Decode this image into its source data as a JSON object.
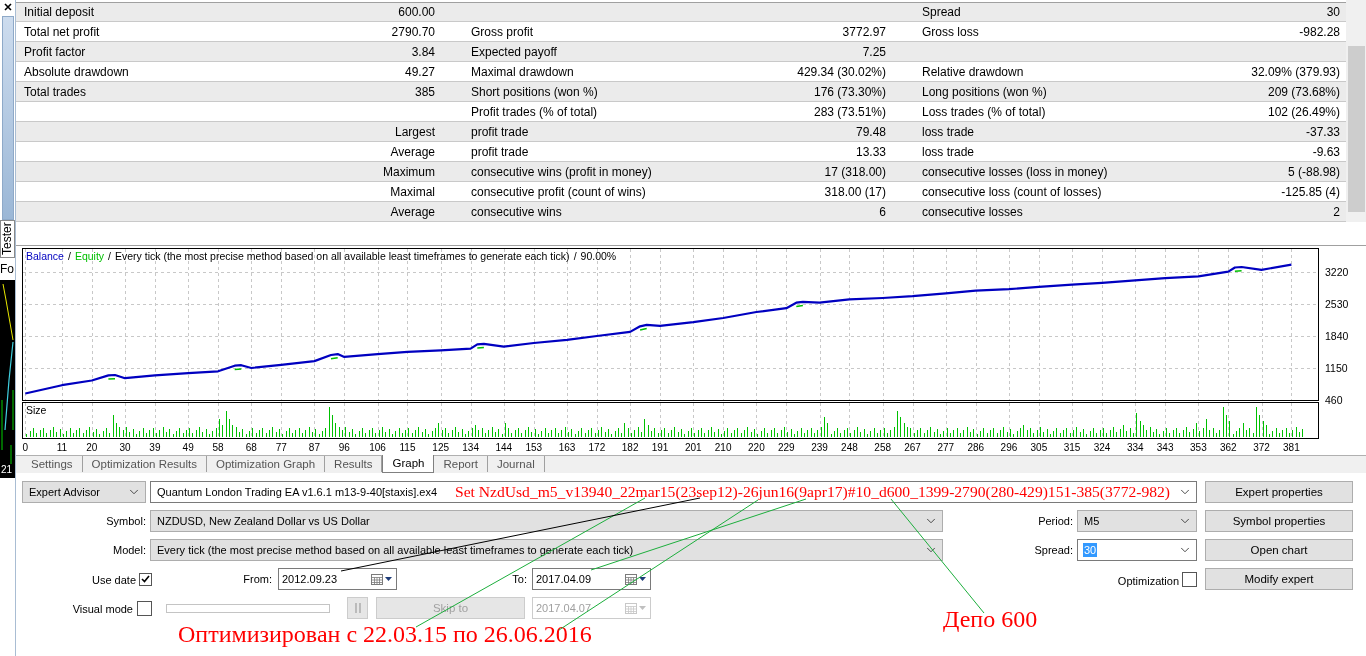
{
  "side_panel": {
    "tab_label": "Tester",
    "cut_label": "Fo",
    "corner_label": "21"
  },
  "report": {
    "rows": [
      {
        "col_1": "Initial deposit",
        "col_2": "600.00",
        "col_5": "Spread",
        "col_6": "30"
      },
      {
        "col_1": "Total net profit",
        "col_2": "2790.70",
        "col_3": "Gross profit",
        "col_4": "3772.97",
        "col_5": "Gross loss",
        "col_6": "-982.28"
      },
      {
        "col_1": "Profit factor",
        "col_2": "3.84",
        "col_3": "Expected payoff",
        "col_4": "7.25"
      },
      {
        "col_1": "Absolute drawdown",
        "col_2": "49.27",
        "col_3": "Maximal drawdown",
        "col_4": "429.34 (30.02%)",
        "col_5": "Relative drawdown",
        "col_6": "32.09% (379.93)"
      },
      {
        "col_1": "Total trades",
        "col_2": "385",
        "col_3": "Short positions (won %)",
        "col_4": "176 (73.30%)",
        "col_5": "Long positions (won %)",
        "col_6": "209 (73.68%)"
      },
      {
        "col_3": "Profit trades (% of total)",
        "col_4": "283 (73.51%)",
        "col_5": "Loss trades (% of total)",
        "col_6": "102 (26.49%)"
      },
      {
        "col_2": "Largest",
        "col_3": "profit trade",
        "col_4": "79.48",
        "col_5": "loss trade",
        "col_6": "-37.33"
      },
      {
        "col_2": "Average",
        "col_3": "profit trade",
        "col_4": "13.33",
        "col_5": "loss trade",
        "col_6": "-9.63"
      },
      {
        "col_2": "Maximum",
        "col_3": "consecutive wins (profit in money)",
        "col_4": "17 (318.00)",
        "col_5": "consecutive losses (loss in money)",
        "col_6": "5 (-88.98)"
      },
      {
        "col_2": "Maximal",
        "col_3": "consecutive profit (count of wins)",
        "col_4": "318.00 (17)",
        "col_5": "consecutive loss (count of losses)",
        "col_6": "-125.85 (4)"
      },
      {
        "col_2": "Average",
        "col_3": "consecutive wins",
        "col_4": "6",
        "col_5": "consecutive losses",
        "col_6": "2"
      }
    ]
  },
  "graph": {
    "separators": [
      "/",
      "/",
      "/"
    ],
    "model": "Every tick (the most precise method based on all available least timeframes to generate each tick)",
    "quality": "90.00%",
    "size_label": "Size",
    "chart_data": {
      "type": "line",
      "grid": true,
      "x": [
        0,
        11,
        20,
        25,
        27,
        30,
        39,
        49,
        58,
        63,
        65,
        68,
        77,
        87,
        92,
        94,
        96,
        106,
        115,
        125,
        134,
        136,
        138,
        144,
        153,
        163,
        172,
        182,
        185,
        187,
        191,
        201,
        210,
        220,
        229,
        232,
        234,
        239,
        248,
        258,
        267,
        277,
        286,
        296,
        305,
        315,
        324,
        334,
        343,
        353,
        362,
        364,
        366,
        372,
        381
      ],
      "series": [
        {
          "name": "Balance",
          "color": "#0000c0",
          "values": [
            600,
            780,
            880,
            990,
            1000,
            930,
            990,
            1040,
            1080,
            1200,
            1210,
            1150,
            1220,
            1300,
            1430,
            1450,
            1390,
            1450,
            1500,
            1530,
            1570,
            1660,
            1670,
            1610,
            1690,
            1760,
            1840,
            1930,
            2050,
            2080,
            2060,
            2140,
            2230,
            2360,
            2440,
            2560,
            2580,
            2560,
            2630,
            2660,
            2700,
            2760,
            2820,
            2850,
            2900,
            2950,
            2990,
            3040,
            3090,
            3130,
            3230,
            3320,
            3330,
            3270,
            3380
          ]
        },
        {
          "name": "Equity",
          "color": "#00c000",
          "values": [
            null,
            null,
            null,
            910,
            920,
            null,
            null,
            null,
            null,
            1120,
            1130,
            null,
            null,
            null,
            1350,
            1370,
            null,
            null,
            null,
            null,
            null,
            1580,
            1590,
            null,
            null,
            null,
            null,
            null,
            1970,
            2000,
            null,
            null,
            null,
            null,
            null,
            2480,
            2500,
            null,
            null,
            null,
            null,
            null,
            null,
            null,
            null,
            null,
            null,
            null,
            null,
            null,
            null,
            3240,
            3250,
            null,
            null
          ]
        }
      ],
      "xlim": [
        -1,
        389
      ],
      "ylim": [
        460,
        3740
      ],
      "xticks": [
        0,
        11,
        20,
        30,
        39,
        49,
        58,
        68,
        77,
        87,
        96,
        106,
        115,
        125,
        134,
        144,
        153,
        163,
        172,
        182,
        191,
        201,
        210,
        220,
        229,
        239,
        248,
        258,
        267,
        277,
        286,
        296,
        305,
        315,
        324,
        334,
        343,
        353,
        362,
        372,
        381
      ],
      "yticks": [
        460,
        1150,
        1840,
        2530,
        3220
      ]
    }
  },
  "tabs": [
    {
      "label": "Settings",
      "selected": false
    },
    {
      "label": "Optimization Results",
      "selected": false
    },
    {
      "label": "Optimization Graph",
      "selected": false
    },
    {
      "label": "Results",
      "selected": false
    },
    {
      "label": "Graph",
      "selected": true
    },
    {
      "label": "Report",
      "selected": false
    },
    {
      "label": "Journal",
      "selected": false
    }
  ],
  "settings": {
    "expert_type": {
      "value": "Expert Advisor"
    },
    "expert": {
      "value": "Quantum London Trading EA v1.6.1 m13-9-40[staxis].ex4"
    },
    "symbol": {
      "label": "Symbol:",
      "value": "NZDUSD, New Zealand Dollar vs US Dollar"
    },
    "period": {
      "label": "Period:",
      "value": "M5"
    },
    "model": {
      "label": "Model:",
      "value": "Every tick (the most precise method based on all available least timeframes to generate each tick)"
    },
    "spread": {
      "label": "Spread:",
      "value": "30",
      "highlighted": true
    },
    "use_date": {
      "label": "Use date",
      "checked": true
    },
    "from": {
      "label": "From:",
      "value": "2012.09.23"
    },
    "to": {
      "label": "To:",
      "value": "2017.04.09"
    },
    "optimization": {
      "label": "Optimization",
      "checked": false
    },
    "visual_mode": {
      "label": "Visual mode",
      "checked": false
    },
    "pause_button": {
      "disabled": true
    },
    "skip_button": {
      "label": "Skip to",
      "disabled": true
    },
    "skip_date": {
      "value": "2017.04.07",
      "disabled": true
    },
    "buttons": [
      {
        "label": "Expert properties"
      },
      {
        "label": "Symbol properties"
      },
      {
        "label": "Open chart"
      },
      {
        "label": "Modify expert"
      }
    ]
  },
  "annotations": {
    "set_name": "Set NzdUsd_m5_v13940_22mar15(23sep12)-26jun16(9apr17)#10_d600_1399-2790(280-429)151-385(3772-982)",
    "notes": [
      {
        "text": "Оптимизирован с 22.03.15 по 26.06.2016"
      },
      {
        "text": "Депо 600"
      }
    ]
  }
}
